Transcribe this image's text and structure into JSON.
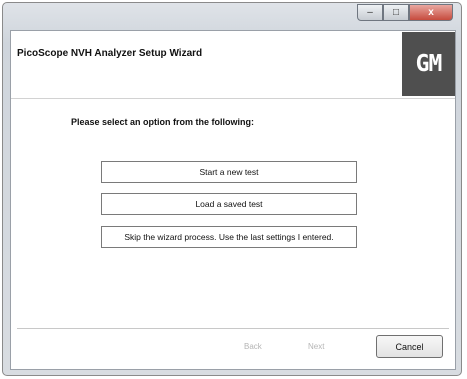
{
  "window": {
    "controls": {
      "minimize": "–",
      "maximize": "□",
      "close": "x"
    }
  },
  "header": {
    "title": "PicoScope NVH Analyzer Setup Wizard",
    "logo_text": "GM"
  },
  "main": {
    "prompt": "Please select an option from the following:",
    "options": [
      "Start a new test",
      "Load a saved test",
      "Skip the wizard process. Use the last settings I entered."
    ]
  },
  "footer": {
    "back_label": "Back",
    "next_label": "Next",
    "cancel_label": "Cancel"
  }
}
